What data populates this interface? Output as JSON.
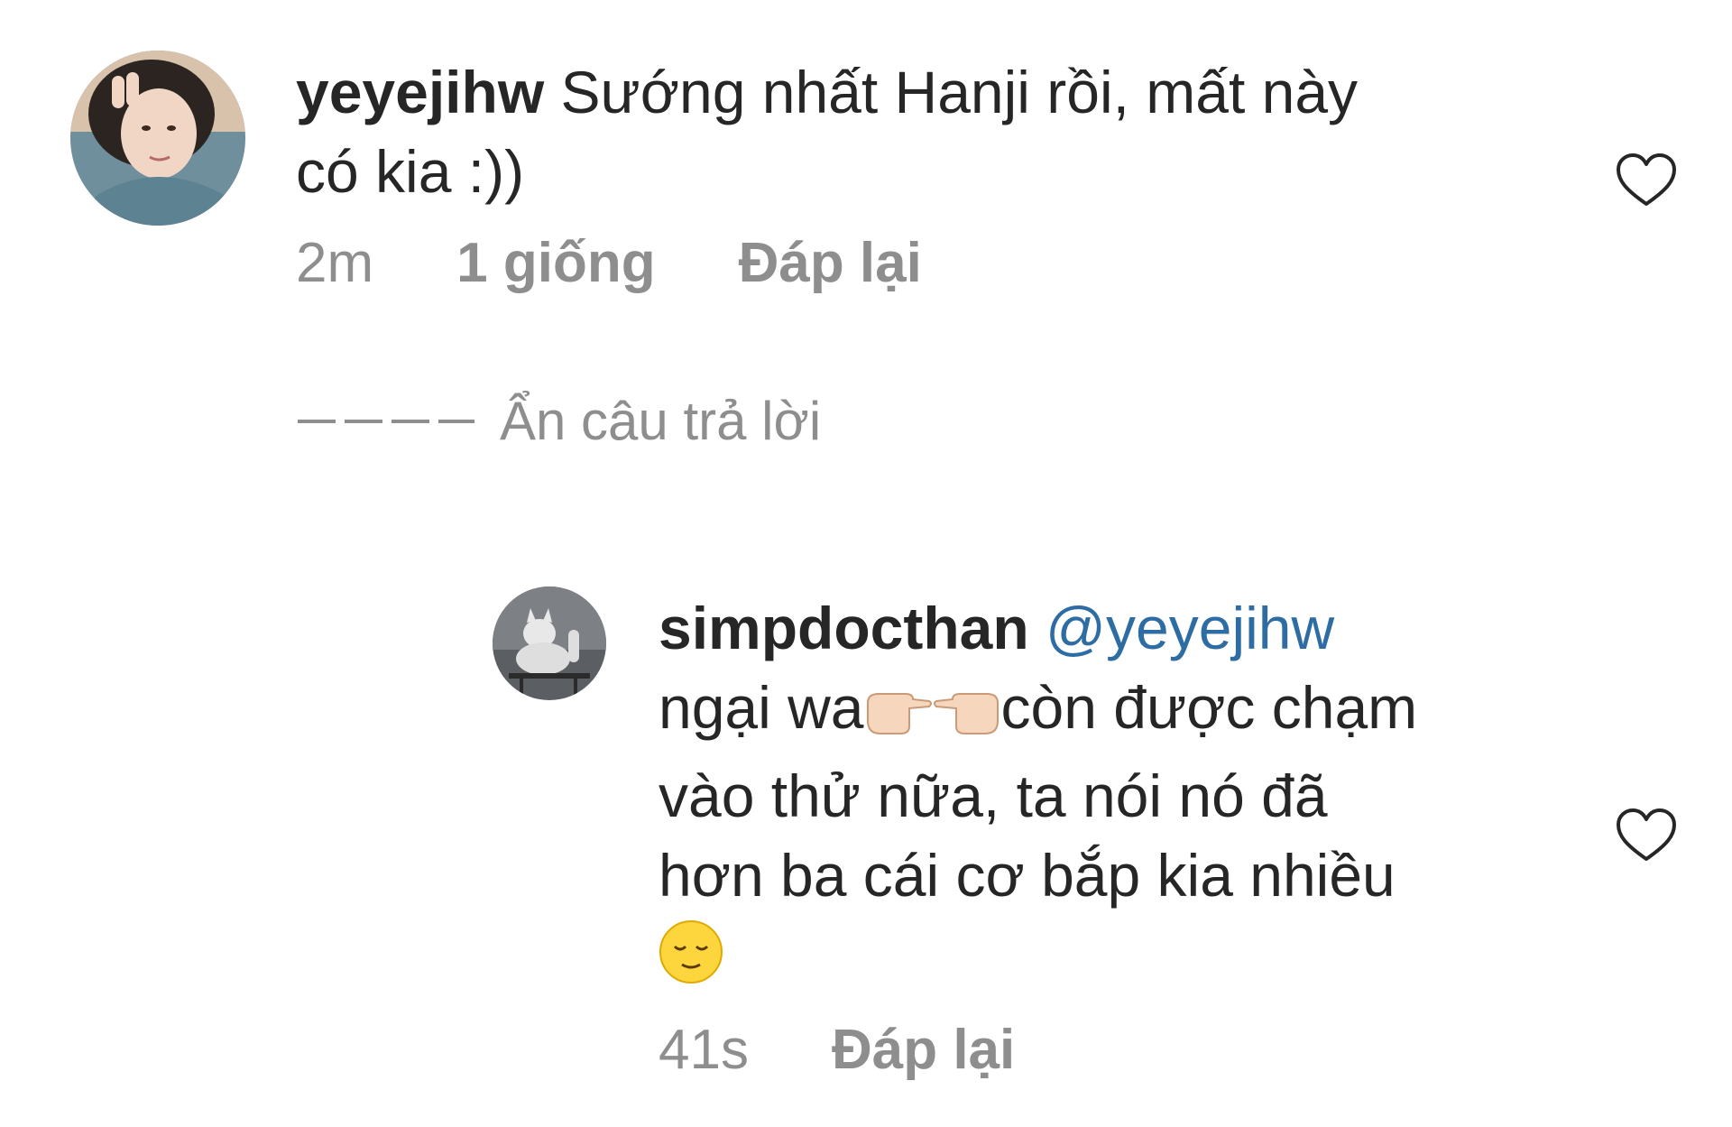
{
  "comments": [
    {
      "avatar_icon": "user-avatar-photo",
      "username": "yeyejihw",
      "text": "Sướng nhất Hanji rồi, mất này có kia :))",
      "time": "2m",
      "likes": "1 giống",
      "reply_label": "Đáp lại",
      "like_icon": "heart-outline-icon"
    }
  ],
  "hide_replies_label": "Ẩn câu trả lời",
  "reply": {
    "avatar_icon": "dog-statue-avatar",
    "username": "simpdocthan",
    "mention": "@yeyejihw",
    "text_before_emoji": "ngại wa",
    "emoji_1": "backhand-index-pointing-right-emoji",
    "emoji_2": "backhand-index-pointing-right-emoji",
    "text_middle": "còn được chạm vào thử nữa, ta nói nó đã hơn ba cái cơ bắp kia nhiều",
    "emoji_3": "relieved-face-emoji",
    "time": "41s",
    "reply_label": "Đáp lại",
    "like_icon": "heart-outline-icon"
  },
  "colors": {
    "text": "#262626",
    "meta": "#8e8e8e",
    "mention": "#2e6da4",
    "background": "#ffffff"
  }
}
